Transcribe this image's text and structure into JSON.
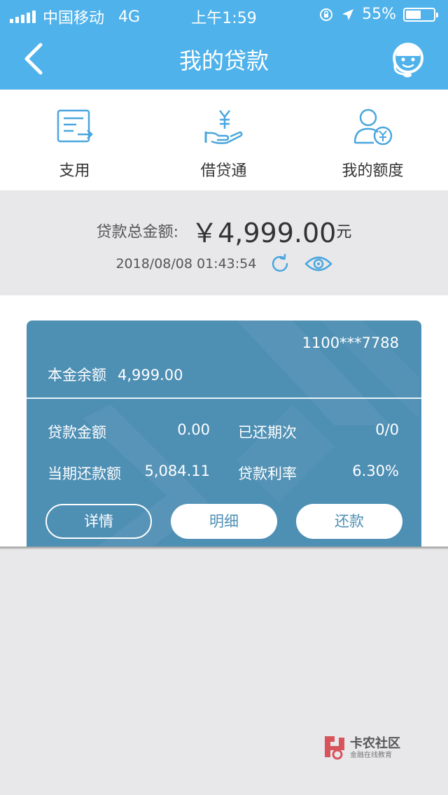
{
  "status_bar": {
    "carrier": "中国移动",
    "network": "4G",
    "time": "上午1:59",
    "battery": "55%",
    "battery_level": 0.55
  },
  "nav": {
    "title": "我的贷款",
    "back_icon": "chevron-left-icon",
    "right_icon": "customer-service-icon"
  },
  "quick_actions": [
    {
      "label": "支用",
      "icon": "document-transfer-icon"
    },
    {
      "label": "借贷通",
      "icon": "yuan-hand-icon"
    },
    {
      "label": "我的额度",
      "icon": "user-yuan-icon"
    }
  ],
  "summary": {
    "total_label": "贷款总金额:",
    "total_amount": "￥4,999.00",
    "total_unit": "元",
    "timestamp": "2018/08/08 01:43:54",
    "refresh_icon": "refresh-icon",
    "eye_icon": "eye-icon"
  },
  "loan_card": {
    "account": "1100***7788",
    "principal_label": "本金余额",
    "principal_value": "4,999.00",
    "rows": [
      {
        "label": "贷款金额",
        "value": "0.00",
        "label2": "已还期次",
        "value2": "0/0"
      },
      {
        "label": "当期还款额",
        "value": "5,084.11",
        "label2": "贷款利率",
        "value2": "6.30%"
      }
    ],
    "buttons": {
      "details": "详情",
      "breakdown": "明细",
      "repay": "还款"
    }
  },
  "watermark": {
    "title": "卡农社区",
    "subtitle": "金融在线教育"
  },
  "colors": {
    "header": "#4fb2ea",
    "card": "#4e8fb4",
    "icon": "#4aa6de",
    "background": "#e8e8ea"
  }
}
